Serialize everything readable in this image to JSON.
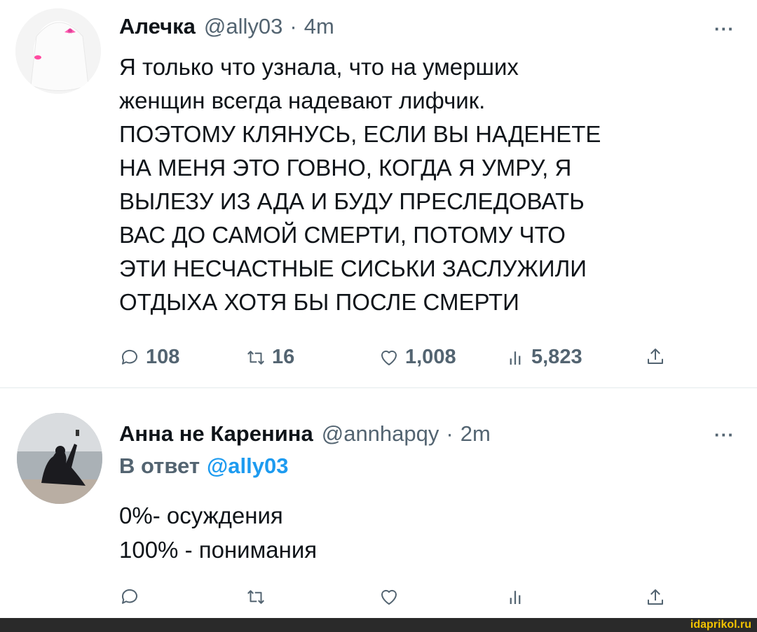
{
  "tweets": [
    {
      "name": "Алечка",
      "handle": "@ally03",
      "separator": "·",
      "time": "4m",
      "more": "···",
      "text_lines": [
        "Я только что узнала, что на умерших",
        "женщин всегда надевают лифчик.",
        "ПОЭТОМУ КЛЯНУСЬ, ЕСЛИ ВЫ НАДЕНЕТЕ",
        "НА МЕНЯ ЭТО ГОВНО, КОГДА Я УМРУ, Я",
        "ВЫЛЕЗУ ИЗ АДА И БУДУ ПРЕСЛЕДОВАТЬ",
        "ВАС ДО САМОЙ СМЕРТИ, ПОТОМУ ЧТО",
        "ЭТИ НЕСЧАСТНЫЕ СИСЬКИ ЗАСЛУЖИЛИ",
        "ОТДЫХА ХОТЯ БЫ ПОСЛЕ СМЕРТИ"
      ],
      "actions": {
        "replies": "108",
        "retweets": "16",
        "likes": "1,008",
        "views": "5,823"
      }
    },
    {
      "name": "Анна не Каренина",
      "handle": "@annhapqy",
      "separator": "·",
      "time": "2m",
      "more": "···",
      "reply_prefix": "В ответ",
      "reply_mention": "@ally03",
      "text_lines": [
        "0%- осуждения",
        "100% - понимания"
      ]
    }
  ],
  "icons": [
    "reply-icon",
    "retweet-icon",
    "like-icon",
    "views-icon",
    "share-icon"
  ],
  "watermark": "idaprikol.ru",
  "colors": {
    "text": "#0f1419",
    "muted": "#536471",
    "link": "#1d9bf0",
    "watermark": "#f2c200"
  }
}
